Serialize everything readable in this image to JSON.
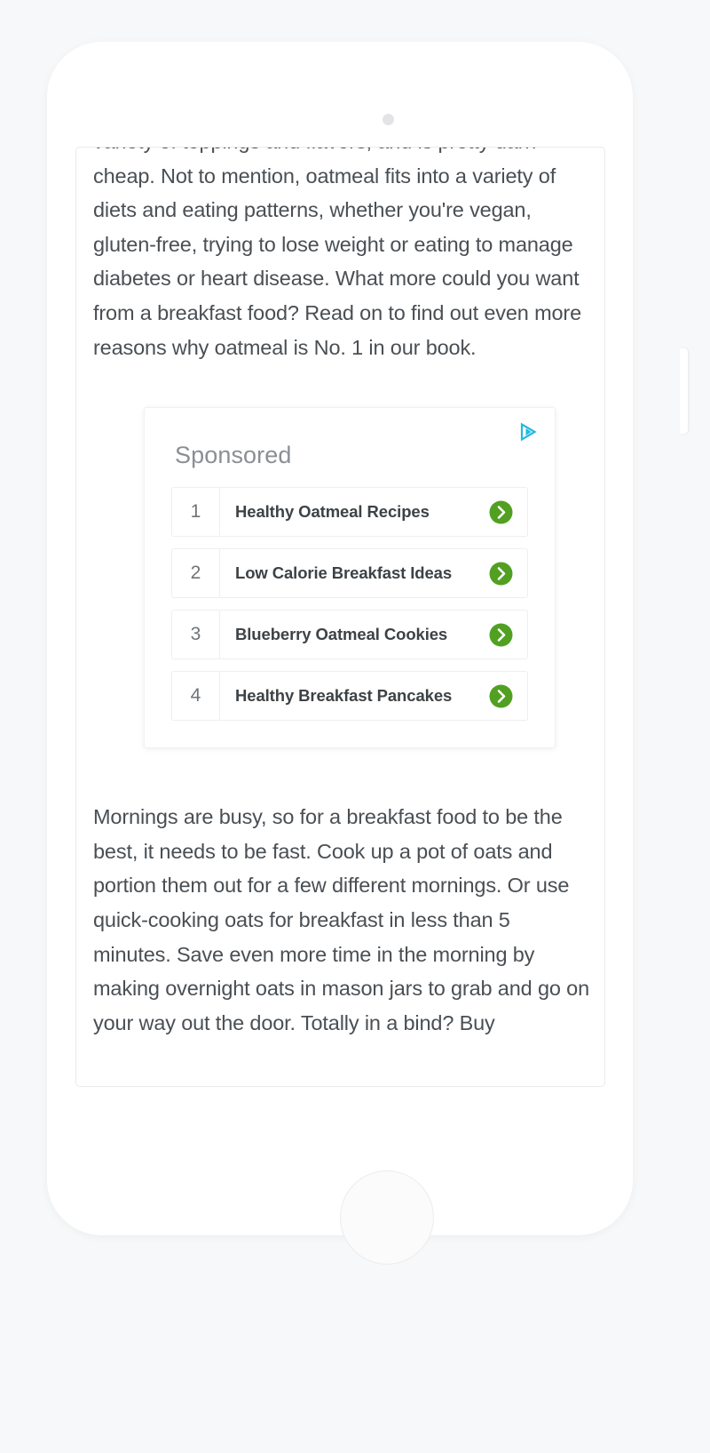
{
  "device": {
    "name": "iphone-mockup",
    "camera_icon": "camera-dot-icon",
    "sensor_icon": "proximity-sensor-icon",
    "speaker_icon": "earpiece-speaker-icon",
    "home_button": "home-button",
    "buttons": {
      "silent": "silent-switch",
      "volume_up": "volume-up-button",
      "volume_down": "volume-down-button",
      "power": "power-button"
    }
  },
  "article": {
    "top_paragraph": {
      "clipped_line": "variety of toppings and flavors, and is pretty darn",
      "body": "cheap. Not to mention, oatmeal fits into a variety of diets and eating patterns, whether you're vegan, gluten-free, trying to lose weight or eating to manage diabetes or heart disease. What more could you want from a breakfast food? Read on to find out even more reasons why oatmeal is No. 1 in our book."
    },
    "bottom_paragraph": {
      "body": "Mornings are busy, so for a breakfast food to be the best, it needs to be fast. Cook up a pot of oats and portion them out for a few different mornings. Or use quick-cooking oats for breakfast in less than 5 minutes. Save even more time in the morning by making overnight oats in mason jars to grab and go on your way out the door. Totally in a bind? Buy"
    }
  },
  "ad": {
    "title": "Sponsored",
    "adchoices_icon": "adchoices-icon",
    "adchoices_color": "#22b8e0",
    "arrow_color": "#51a022",
    "arrow_icon": "chevron-right-circle-icon",
    "rows": [
      {
        "rank": "1",
        "label": "Healthy Oatmeal Recipes"
      },
      {
        "rank": "2",
        "label": "Low Calorie Breakfast Ideas"
      },
      {
        "rank": "3",
        "label": "Blueberry Oatmeal Cookies"
      },
      {
        "rank": "4",
        "label": "Healthy Breakfast Pancakes"
      }
    ]
  },
  "colors": {
    "page_background": "#f7f8f9",
    "frame": "#ffffff",
    "body_text": "#4a4f54",
    "ad_title_text": "#8a8f94",
    "ad_label_text": "#3d4246",
    "ad_border": "#efefef"
  }
}
